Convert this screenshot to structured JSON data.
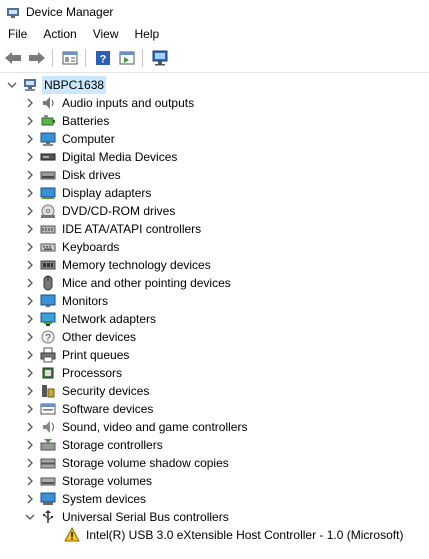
{
  "window": {
    "title": "Device Manager"
  },
  "menu": [
    "File",
    "Action",
    "View",
    "Help"
  ],
  "toolbar": {
    "buttons": [
      "back-icon",
      "forward-icon",
      "properties-icon",
      "help-icon",
      "action-pane-icon",
      "scan-hardware-icon"
    ]
  },
  "tree": {
    "root": "NBPC1638",
    "categories": [
      {
        "label": "Audio inputs and outputs",
        "icon": "speaker-icon"
      },
      {
        "label": "Batteries",
        "icon": "battery-icon"
      },
      {
        "label": "Computer",
        "icon": "computer-icon"
      },
      {
        "label": "Digital Media Devices",
        "icon": "media-device-icon"
      },
      {
        "label": "Disk drives",
        "icon": "disk-drive-icon"
      },
      {
        "label": "Display adapters",
        "icon": "display-adapter-icon"
      },
      {
        "label": "DVD/CD-ROM drives",
        "icon": "dvd-drive-icon"
      },
      {
        "label": "IDE ATA/ATAPI controllers",
        "icon": "ide-controller-icon"
      },
      {
        "label": "Keyboards",
        "icon": "keyboard-icon"
      },
      {
        "label": "Memory technology devices",
        "icon": "memory-icon"
      },
      {
        "label": "Mice and other pointing devices",
        "icon": "mouse-icon"
      },
      {
        "label": "Monitors",
        "icon": "monitor-icon"
      },
      {
        "label": "Network adapters",
        "icon": "network-adapter-icon"
      },
      {
        "label": "Other devices",
        "icon": "other-devices-icon"
      },
      {
        "label": "Print queues",
        "icon": "printer-icon"
      },
      {
        "label": "Processors",
        "icon": "processor-icon"
      },
      {
        "label": "Security devices",
        "icon": "security-device-icon"
      },
      {
        "label": "Software devices",
        "icon": "software-device-icon"
      },
      {
        "label": "Sound, video and game controllers",
        "icon": "sound-controller-icon"
      },
      {
        "label": "Storage controllers",
        "icon": "storage-controller-icon"
      },
      {
        "label": "Storage volume shadow copies",
        "icon": "shadow-copy-icon"
      },
      {
        "label": "Storage volumes",
        "icon": "storage-volume-icon"
      },
      {
        "label": "System devices",
        "icon": "system-device-icon"
      },
      {
        "label": "Universal Serial Bus controllers",
        "icon": "usb-icon",
        "expanded": true,
        "children": [
          {
            "label": "Intel(R) USB 3.0 eXtensible Host Controller - 1.0 (Microsoft)",
            "icon": "warning-icon"
          }
        ]
      }
    ]
  },
  "colors": {
    "selection": "#cce8ff",
    "warning": "#f5c518",
    "accent": "#3a7bd5"
  }
}
